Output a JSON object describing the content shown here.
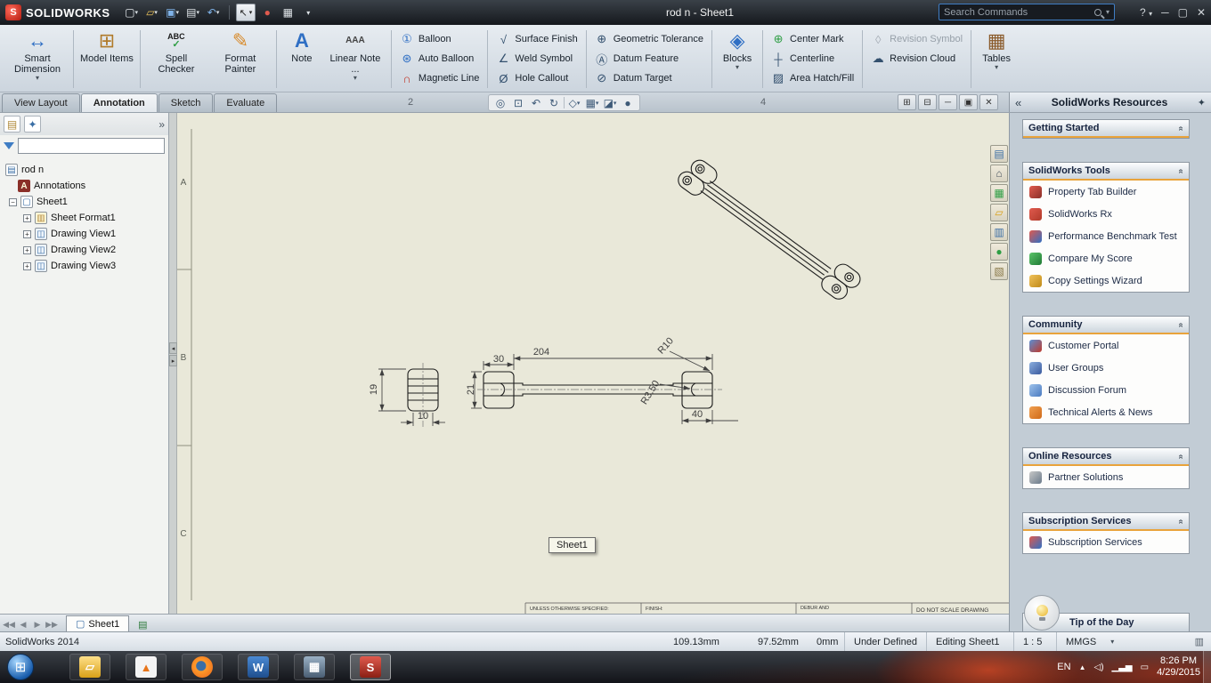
{
  "titlebar": {
    "logo": "SOLIDWORKS",
    "title": "rod n - Sheet1",
    "search": "Search Commands"
  },
  "tabs": {
    "view_layout": "View Layout",
    "annotation": "Annotation",
    "sketch": "Sketch",
    "evaluate": "Evaluate"
  },
  "ribbon": {
    "smart_dimension": "Smart Dimension",
    "model_items": "Model Items",
    "spell_checker": "Spell Checker",
    "format_painter": "Format Painter",
    "note": "Note",
    "linear_note": "Linear Note ...",
    "balloon": "Balloon",
    "auto_balloon": "Auto Balloon",
    "magnetic_line": "Magnetic Line",
    "surface_finish": "Surface Finish",
    "weld_symbol": "Weld Symbol",
    "hole_callout": "Hole Callout",
    "geometric_tolerance": "Geometric Tolerance",
    "datum_feature": "Datum Feature",
    "datum_target": "Datum Target",
    "blocks": "Blocks",
    "center_mark": "Center Mark",
    "centerline": "Centerline",
    "area_hatch": "Area Hatch/Fill",
    "revision_symbol": "Revision Symbol",
    "revision_cloud": "Revision Cloud",
    "tables": "Tables"
  },
  "tree": {
    "root": "rod n",
    "annotations": "Annotations",
    "sheet1": "Sheet1",
    "sheet_format1": "Sheet Format1",
    "view1": "Drawing View1",
    "view2": "Drawing View2",
    "view3": "Drawing View3"
  },
  "viewport": {
    "zone2": "2",
    "zone4": "4",
    "rowA": "A",
    "rowB": "B",
    "rowC": "C",
    "tooltip": "Sheet1",
    "tb_unless": "UNLESS OTHERWISE SPECIFIED:",
    "tb_finish": "FINISH:",
    "tb_debur": "DEBUR AND",
    "tb_noscale": "DO NOT SCALE DRAWING"
  },
  "dims": {
    "d30": "30",
    "d204": "204",
    "r10": "R10",
    "r350": "R3.50",
    "d21": "21",
    "d19": "19",
    "d10": "10",
    "d40": "40"
  },
  "sheettabs": {
    "sheet1": "Sheet1"
  },
  "resources": {
    "title": "SolidWorks Resources",
    "getting_started": "Getting Started",
    "tools": "SolidWorks Tools",
    "tools_items": [
      "Property Tab Builder",
      "SolidWorks Rx",
      "Performance Benchmark Test",
      "Compare My Score",
      "Copy Settings Wizard"
    ],
    "community": "Community",
    "community_items": [
      "Customer Portal",
      "User Groups",
      "Discussion Forum",
      "Technical Alerts & News"
    ],
    "online": "Online Resources",
    "online_items": [
      "Partner Solutions"
    ],
    "subscription": "Subscription Services",
    "subscription_items": [
      "Subscription Services"
    ],
    "tip": "Tip of the Day"
  },
  "statusbar": {
    "app": "SolidWorks 2014",
    "x": "109.13mm",
    "y": "97.52mm",
    "z": "0mm",
    "state": "Under Defined",
    "editing": "Editing Sheet1",
    "scale": "1 : 5",
    "units": "MMGS"
  },
  "taskbar": {
    "lang": "EN",
    "time": "8:26 PM",
    "date": "4/29/2015"
  }
}
